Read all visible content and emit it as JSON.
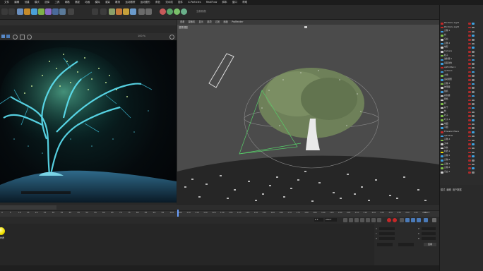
{
  "menubar": {
    "items": [
      "文件",
      "编辑",
      "创建",
      "模式",
      "选择",
      "工具",
      "网格",
      "捕捉",
      "动画",
      "模拟",
      "渲染",
      "雕刻",
      "运动跟踪",
      "运动图形",
      "角色",
      "流水线",
      "插件",
      "X-Particles",
      "RealFlow",
      "脚本",
      "窗口",
      "帮助"
    ]
  },
  "toolbar": {
    "status_text": "当前相机"
  },
  "left_viewport": {
    "label": "100 %"
  },
  "viewport": {
    "menu_items": [
      "查看",
      "摄像机",
      "显示",
      "选项",
      "过滤",
      "面板",
      "ProRender"
    ],
    "camera_label": "透视视图"
  },
  "object_manager": {
    "rows": [
      {
        "name": "RS Dome Light",
        "color": "#c62828"
      },
      {
        "name": "RS Dome Light",
        "color": "#c62828"
      },
      {
        "name": "克隆.1",
        "color": "#3ea0e0"
      },
      {
        "name": "树",
        "color": "#7fc14a"
      },
      {
        "name": "空白",
        "color": "#cfcfcf"
      },
      {
        "name": "克隆.2",
        "color": "#3ea0e0"
      },
      {
        "name": "地形",
        "color": "#cfcfcf"
      },
      {
        "name": "Camera",
        "color": "#cfcfcf"
      },
      {
        "name": "粒子",
        "color": "#7fc14a"
      },
      {
        "name": "发射器.1",
        "color": "#3ea0e0"
      },
      {
        "name": "追踪对象",
        "color": "#3ea0e0"
      },
      {
        "name": "xpEmitter.1",
        "color": "#c62828"
      },
      {
        "name": "xpTrail.1",
        "color": "#3ea0e0"
      },
      {
        "name": "力场",
        "color": "#7fc14a"
      },
      {
        "name": "运动图形",
        "color": "#3ea0e0"
      },
      {
        "name": "克隆.3",
        "color": "#7fc14a"
      },
      {
        "name": "效果器",
        "color": "#cfcfcf"
      },
      {
        "name": "随机",
        "color": "#3ea0e0"
      },
      {
        "name": "着色器",
        "color": "#cfcfcf"
      },
      {
        "name": "网格",
        "color": "#cfcfcf"
      },
      {
        "name": "树",
        "color": "#7fc14a"
      },
      {
        "name": "树干",
        "color": "#cfcfcf"
      },
      {
        "name": "枝",
        "color": "#cfcfcf"
      },
      {
        "name": "叶子",
        "color": "#7fc14a"
      },
      {
        "name": "叶子.1",
        "color": "#7fc14a"
      },
      {
        "name": "地面",
        "color": "#cfcfcf"
      },
      {
        "name": "平面",
        "color": "#3ea0e0"
      },
      {
        "name": "Emission Plane",
        "color": "#c62828"
      },
      {
        "name": "xpFollow",
        "color": "#3ea0e0"
      },
      {
        "name": "克隆.4",
        "color": "#7fc14a"
      },
      {
        "name": "文本",
        "color": "#cfcfcf"
      },
      {
        "name": "对象",
        "color": "#cfcfcf"
      },
      {
        "name": "材质.1",
        "color": "#f2e300"
      },
      {
        "name": "克隆.5",
        "color": "#3ea0e0"
      },
      {
        "name": "克隆.6",
        "color": "#3ea0e0"
      },
      {
        "name": "克隆.7",
        "color": "#7fc14a"
      },
      {
        "name": "克隆.8",
        "color": "#7fc14a"
      },
      {
        "name": "空白.1",
        "color": "#cfcfcf"
      }
    ]
  },
  "attributes": {
    "tabs": [
      "模式",
      "编辑",
      "用户数据"
    ]
  },
  "timeline": {
    "ticks": [
      "0",
      "5",
      "10",
      "15",
      "20",
      "25",
      "30",
      "35",
      "40",
      "45",
      "50",
      "55",
      "60",
      "65",
      "70",
      "75",
      "80",
      "85",
      "90",
      "95",
      "100",
      "105",
      "110",
      "115",
      "120",
      "125",
      "130",
      "135",
      "140",
      "145",
      "150",
      "155",
      "160",
      "165",
      "170",
      "175",
      "180",
      "185",
      "190",
      "195",
      "200",
      "205",
      "210",
      "215",
      "220",
      "225",
      "230",
      "235",
      "240",
      "245",
      "250"
    ],
    "end_frame": "250 F",
    "current_frame": "0 F",
    "start_field": "0 F",
    "end_field": "250 F"
  },
  "materials": {
    "ball_name": "材质",
    "ball_color": "#f2e300"
  },
  "coordinates": {
    "labels": [
      "X",
      "Y",
      "Z",
      "H",
      "P",
      "B"
    ],
    "apply_label": "应用"
  }
}
